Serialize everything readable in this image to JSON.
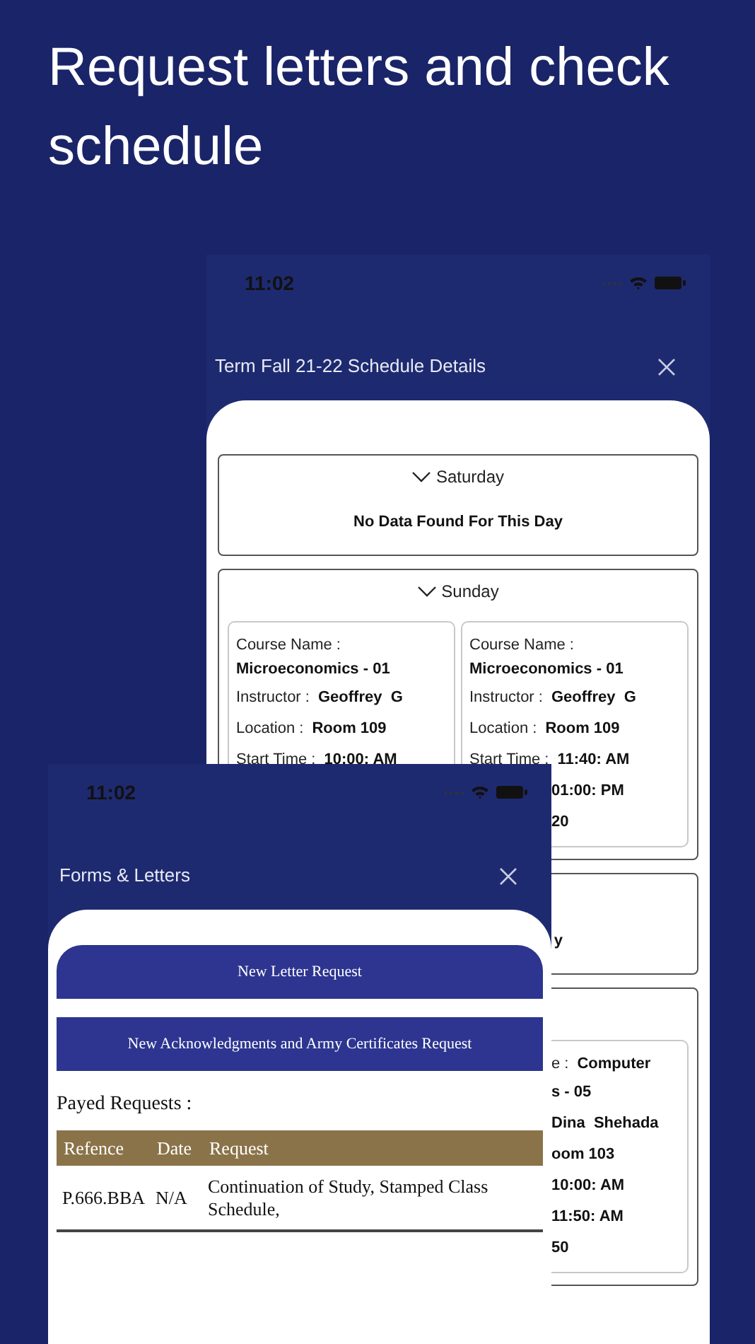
{
  "headline": "Request letters and check schedule",
  "schedule_screen": {
    "status_bar": {
      "time": "11:02"
    },
    "title": "Term Fall 21-22 Schedule Details",
    "days": [
      {
        "day": "Saturday",
        "message": {
          "text": "No Data Found For This Day",
          "kind": "centered"
        }
      },
      {
        "day": "Sunday",
        "courses": [
          {
            "lines": [
              {
                "kind": "label",
                "label": "Course Name :"
              },
              {
                "kind": "value",
                "value": "Microeconomics - 01"
              },
              {
                "kind": "pair",
                "label": "Instructor :",
                "value": "Geoffrey  G"
              },
              {
                "kind": "pair",
                "label": "Location :",
                "value": "Room 109"
              },
              {
                "kind": "pair",
                "label": "Start Time :",
                "value": "10:00: AM"
              }
            ]
          },
          {
            "lines": [
              {
                "kind": "label",
                "label": "Course Name :"
              },
              {
                "kind": "value",
                "value": "Microeconomics - 01"
              },
              {
                "kind": "pair",
                "label": "Instructor :",
                "value": "Geoffrey  G"
              },
              {
                "kind": "pair",
                "label": "Location :",
                "value": "Room 109"
              },
              {
                "kind": "pair",
                "label": "Start Time :",
                "value": "11:40: AM"
              },
              {
                "kind": "fragment",
                "value": "01:00: PM"
              },
              {
                "kind": "fragment",
                "value": "20"
              }
            ]
          }
        ]
      },
      {
        "message": {
          "text": "y",
          "kind": "fragment"
        }
      },
      {
        "courses": [
          {
            "lines": [
              {
                "kind": "fragment",
                "label": "e :",
                "value": "Computer"
              },
              {
                "kind": "fragment",
                "value": "s - 05"
              },
              {
                "kind": "fragment",
                "value": "Dina  Shehada"
              },
              {
                "kind": "fragment",
                "value": "oom 103"
              },
              {
                "kind": "fragment",
                "value": "10:00: AM"
              },
              {
                "kind": "fragment",
                "value": "11:50: AM"
              },
              {
                "kind": "fragment",
                "value": "50"
              }
            ]
          }
        ]
      }
    ]
  },
  "forms_screen": {
    "status_bar": {
      "time": "11:02"
    },
    "title": "Forms & Letters",
    "buttons": [
      {
        "label": "New Letter Request",
        "kind": "rounded"
      },
      {
        "label": "New Acknowledgments and Army Certificates Request",
        "kind": "square"
      }
    ],
    "section_label": "Payed Requests :",
    "table": {
      "columns": [
        "Refence",
        "Date",
        "Request"
      ],
      "rows": [
        {
          "cells": [
            "P.666.BBA",
            "N/A",
            "Continuation of Study, Stamped Class Schedule,"
          ]
        }
      ]
    }
  }
}
